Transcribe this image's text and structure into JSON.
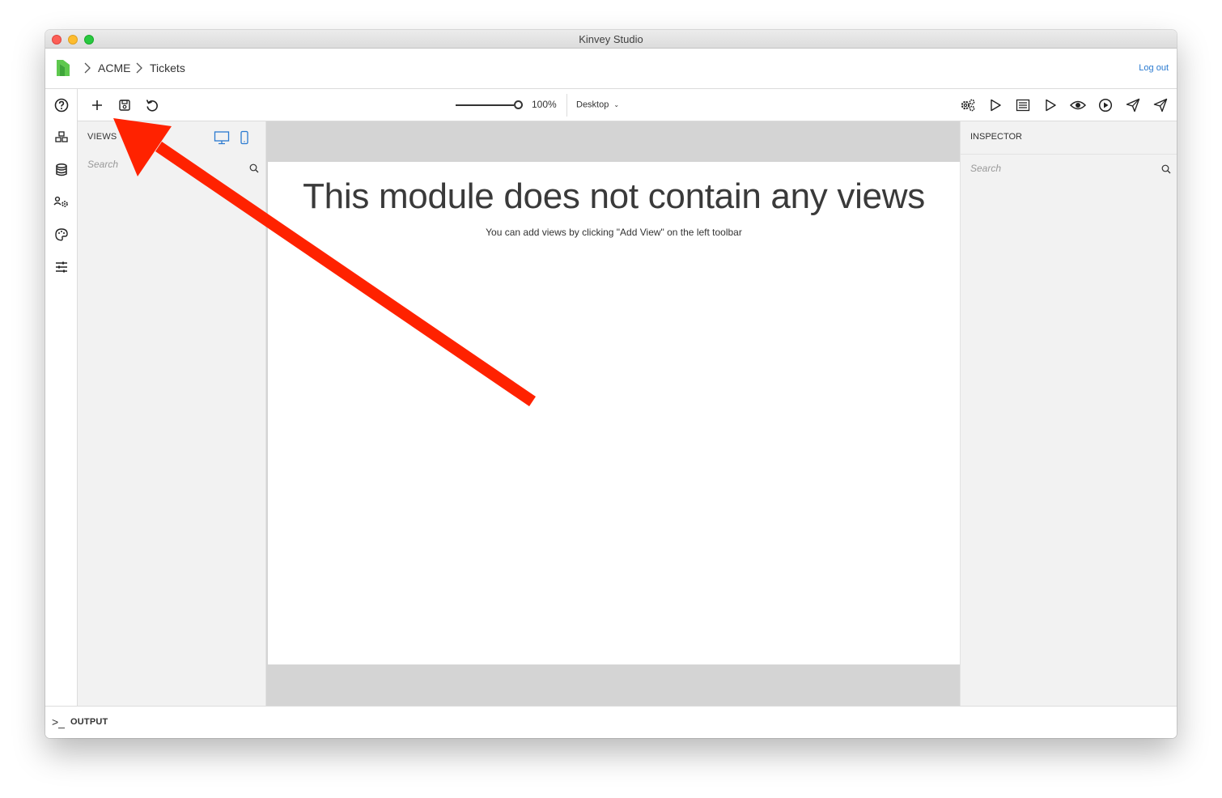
{
  "window": {
    "title": "Kinvey Studio"
  },
  "breadcrumb": {
    "items": [
      "ACME",
      "Tickets"
    ]
  },
  "header": {
    "logout_label": "Log out"
  },
  "toolbar": {
    "zoom_value": "100%",
    "zoom_level": 1.0,
    "device_selected": "Desktop",
    "left_icons": [
      "add-view-icon",
      "save-icon",
      "undo-icon"
    ],
    "right_icons": [
      "settings-icon",
      "run-icon",
      "list-icon",
      "play-icon",
      "preview-icon",
      "play-circle-icon",
      "send-icon",
      "send-alt-icon",
      "publish-icon"
    ]
  },
  "left_rail": {
    "icons": [
      "help-icon",
      "modules-icon",
      "data-icon",
      "users-settings-icon",
      "theme-icon",
      "settings-sliders-icon"
    ]
  },
  "views_panel": {
    "title": "VIEWS",
    "search_placeholder": "Search"
  },
  "canvas": {
    "empty_title": "This module does not contain any views",
    "empty_subtitle": "You can add views by clicking \"Add View\" on the left toolbar"
  },
  "inspector": {
    "title": "INSPECTOR",
    "search_placeholder": "Search"
  },
  "output": {
    "prompt": ">_",
    "label": "OUTPUT"
  },
  "colors": {
    "accent": "#2a7ad0",
    "logo": "#5ec84e",
    "annotation_arrow": "#ff2200"
  }
}
